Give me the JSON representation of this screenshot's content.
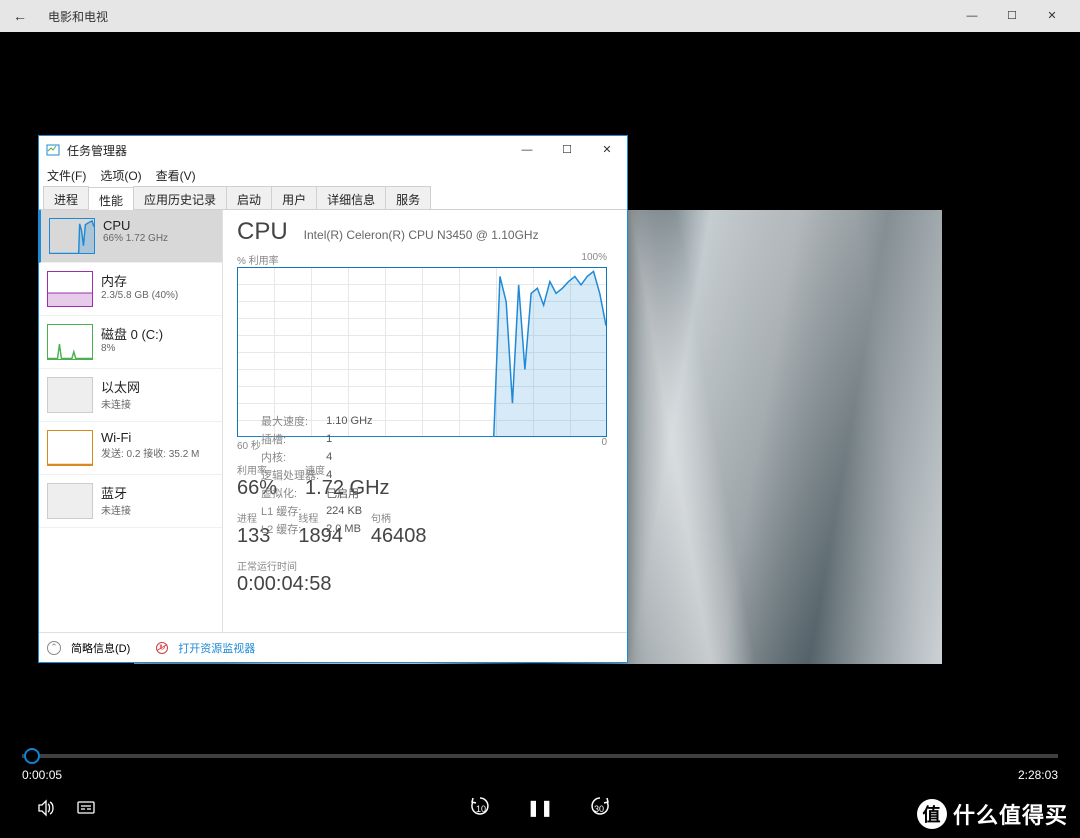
{
  "mtv": {
    "title": "电影和电视",
    "back_glyph": "←",
    "min_glyph": "—",
    "max_glyph": "☐",
    "close_glyph": "✕"
  },
  "player": {
    "time_current": "0:00:05",
    "time_total": "2:28:03",
    "skip_back": "10",
    "skip_fwd": "30",
    "pause_glyph": "❚❚"
  },
  "watermark": {
    "circle": "值",
    "text": "什么值得买"
  },
  "tmgr": {
    "title": "任务管理器",
    "menu": {
      "file": "文件(F)",
      "options": "选项(O)",
      "view": "查看(V)"
    },
    "tabs": [
      "进程",
      "性能",
      "应用历史记录",
      "启动",
      "用户",
      "详细信息",
      "服务"
    ],
    "active_tab_index": 1,
    "side": {
      "cpu": {
        "title": "CPU",
        "sub": "66% 1.72 GHz",
        "color": "#1e8ad6"
      },
      "mem": {
        "title": "内存",
        "sub": "2.3/5.8 GB (40%)",
        "color": "#9b2fae"
      },
      "disk": {
        "title": "磁盘 0 (C:)",
        "sub": "8%",
        "color": "#4caf50"
      },
      "eth": {
        "title": "以太网",
        "sub": "未连接",
        "color": "#bbbbbb"
      },
      "wifi": {
        "title": "Wi-Fi",
        "sub": "发送: 0.2 接收: 35.2 M",
        "color": "#d88a1e"
      },
      "bt": {
        "title": "蓝牙",
        "sub": "未连接",
        "color": "#bbbbbb"
      }
    },
    "main": {
      "heading": "CPU",
      "cpu_name": "Intel(R) Celeron(R) CPU N3450 @ 1.10GHz",
      "util_label": "% 利用率",
      "util_max": "100%",
      "x_left": "60 秒",
      "x_right": "0",
      "stats1": {
        "util_l": "利用率",
        "util_v": "66%",
        "speed_l": "速度",
        "speed_v": "1.72 GHz"
      },
      "stats2": {
        "proc_l": "进程",
        "proc_v": "133",
        "thread_l": "线程",
        "thread_v": "1894",
        "handle_l": "句柄",
        "handle_v": "46408"
      },
      "uptime_l": "正常运行时间",
      "uptime_v": "0:00:04:58",
      "info": {
        "maxspeed_l": "最大速度:",
        "maxspeed_v": "1.10 GHz",
        "sockets_l": "插槽:",
        "sockets_v": "1",
        "cores_l": "内核:",
        "cores_v": "4",
        "lproc_l": "逻辑处理器:",
        "lproc_v": "4",
        "virt_l": "虚拟化:",
        "virt_v": "已启用",
        "l1_l": "L1 缓存:",
        "l1_v": "224 KB",
        "l2_l": "L2 缓存:",
        "l2_v": "2.0 MB"
      }
    },
    "footer": {
      "less": "简略信息(D)",
      "resmon": "打开资源监视器",
      "chev": "⌃",
      "blocked_inner": "↻"
    }
  },
  "chart_data": {
    "type": "line",
    "title": "CPU % 利用率",
    "xlabel": "秒",
    "ylabel": "% 利用率",
    "ylim": [
      0,
      100
    ],
    "xlim_label": [
      "60 秒",
      "0"
    ],
    "x": [
      0,
      1,
      2,
      3,
      4,
      5,
      6,
      7,
      8,
      9,
      10,
      11,
      12,
      13,
      14,
      15,
      16,
      17,
      18,
      19,
      20,
      21,
      22,
      23,
      24,
      25,
      26,
      27,
      28,
      29,
      30,
      31,
      32,
      33,
      34,
      35,
      36,
      37,
      38,
      39,
      40,
      41,
      42,
      43,
      44,
      45,
      46,
      47,
      48,
      49,
      50,
      51,
      52,
      53,
      54,
      55,
      56,
      57,
      58,
      59
    ],
    "values": [
      0,
      0,
      0,
      0,
      0,
      0,
      0,
      0,
      0,
      0,
      0,
      0,
      0,
      0,
      0,
      0,
      0,
      0,
      0,
      0,
      0,
      0,
      0,
      0,
      0,
      0,
      0,
      0,
      0,
      0,
      0,
      0,
      0,
      0,
      0,
      0,
      0,
      0,
      0,
      0,
      0,
      0,
      95,
      80,
      20,
      90,
      40,
      85,
      88,
      78,
      92,
      85,
      88,
      92,
      95,
      90,
      95,
      98,
      85,
      66
    ]
  }
}
